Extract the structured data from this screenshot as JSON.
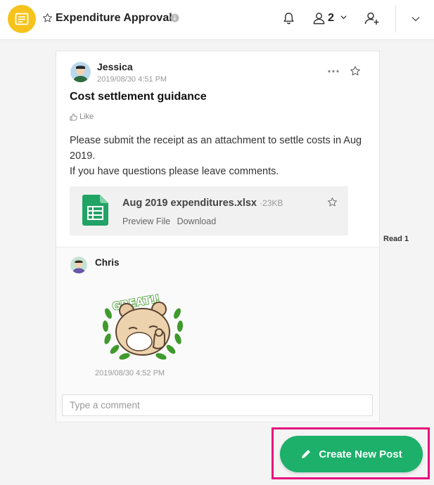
{
  "header": {
    "title": "Expenditure Approval",
    "member_count": "2"
  },
  "post": {
    "author": "Jessica",
    "time": "2019/08/30 4:51 PM",
    "title": "Cost settlement guidance",
    "like_label": "Like",
    "body_line1": "Please submit the receipt as an attachment to settle costs in Aug 2019.",
    "body_line2": "If you have questions please leave comments.",
    "attachment": {
      "name": "Aug 2019 expenditures.xlsx",
      "size": "·23KB",
      "preview_label": "Preview File",
      "download_label": "Download"
    },
    "read_label": "Read 1"
  },
  "comment": {
    "author": "Chris",
    "time": "2019/08/30 4:52 PM",
    "sticker_text": "GREAT!!",
    "input_placeholder": "Type a comment"
  },
  "create_button_label": "Create New Post",
  "colors": {
    "app_icon": "#f6c31c",
    "create_button": "#1db06a",
    "highlight": "#e5117b",
    "excel_green": "#21a366"
  }
}
